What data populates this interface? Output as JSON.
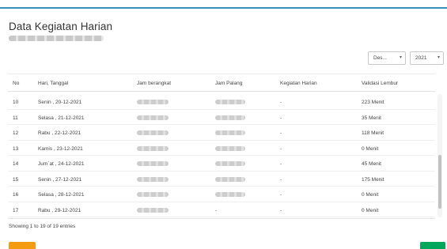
{
  "page": {
    "title": "Data Kegiatan Harian",
    "filters": {
      "month": "Des...",
      "year": "2021"
    }
  },
  "table": {
    "columns": [
      "No",
      "Hari, Tanggal",
      "Jam berangkat",
      "Jam Palang",
      "Kegiatan Harian",
      "Validasi Lembur"
    ],
    "rows": [
      {
        "no": "10",
        "day": "Senin , 20-12-2021",
        "activity": "-",
        "validation": "223 Menit"
      },
      {
        "no": "11",
        "day": "Selasa , 21-12-2021",
        "activity": "-",
        "validation": "35 Menit"
      },
      {
        "no": "12",
        "day": "Rabu , 22-12-2021",
        "activity": "-",
        "validation": "118 Menit"
      },
      {
        "no": "13",
        "day": "Kamis , 23-12-2021",
        "activity": "-",
        "validation": "0 Menit"
      },
      {
        "no": "14",
        "day": "Jum`at , 24-12-2021",
        "activity": "-",
        "validation": "45 Menit"
      },
      {
        "no": "15",
        "day": "Senin , 27-12-2021",
        "activity": "-",
        "validation": "175 Menit"
      },
      {
        "no": "16",
        "day": "Selasa , 28-12-2021",
        "activity": "-",
        "validation": "0 Menit"
      },
      {
        "no": "17",
        "day": "Rabu , 29-12-2021",
        "activity": "-",
        "activity_out": "-",
        "validation": "0 Menit"
      }
    ],
    "info": "Showing 1 to 19 of 19 entries"
  },
  "icons": {
    "caret": "chevron-down-icon"
  }
}
